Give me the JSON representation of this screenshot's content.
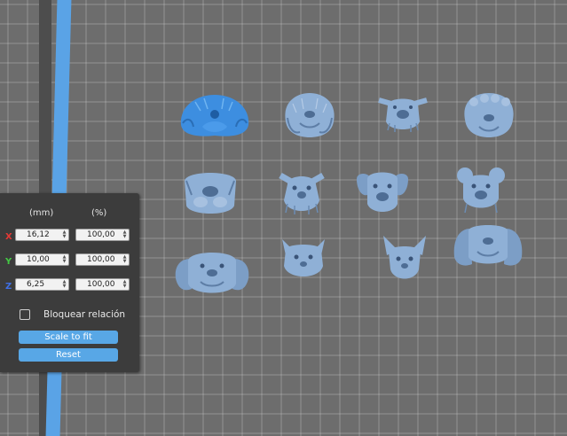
{
  "scale_panel": {
    "headers": {
      "mm": "(mm)",
      "percent": "(%)"
    },
    "rows": [
      {
        "axis": "X",
        "axis_color": "#e53935",
        "mm": "16,12",
        "percent": "100,00"
      },
      {
        "axis": "Y",
        "axis_color": "#43c743",
        "mm": "10,00",
        "percent": "100,00"
      },
      {
        "axis": "Z",
        "axis_color": "#3f6fe6",
        "mm": "6,25",
        "percent": "100,00"
      }
    ],
    "lock_ratio": {
      "label": "Bloquear relación",
      "checked": false
    },
    "scale_to_fit_label": "Scale to fit",
    "reset_label": "Reset"
  },
  "scene": {
    "model_count": 12,
    "selected_model_index": 0,
    "colors": {
      "model": "#8fb0d6",
      "model_selected": "#3f8fe0",
      "build_plate_edge": "#5aa3e6",
      "grid_background": "#6d6d6d"
    }
  }
}
